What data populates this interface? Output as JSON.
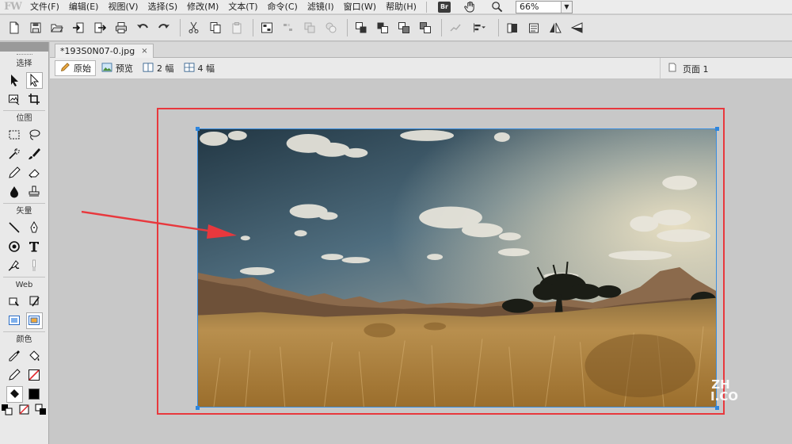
{
  "app": {
    "logo": "FW"
  },
  "menu": {
    "items": [
      "文件(F)",
      "编辑(E)",
      "视图(V)",
      "选择(S)",
      "修改(M)",
      "文本(T)",
      "命令(C)",
      "滤镜(I)",
      "窗口(W)",
      "帮助(H)"
    ],
    "bridge_label": "Br",
    "zoom": "66%"
  },
  "toolbar": {
    "icons": [
      "new-document-icon",
      "save-icon",
      "open-icon",
      "import-icon",
      "export-icon",
      "print-icon",
      "undo-icon",
      "redo-icon",
      "cut-icon",
      "copy-icon",
      "paste-icon",
      "group-icon",
      "ungroup-icon",
      "join-icon",
      "split-icon",
      "bring-front-icon",
      "bring-forward-icon",
      "send-backward-icon",
      "send-back-icon",
      "disabled-align-icon",
      "align-icon",
      "rotate-left-icon",
      "rotate-right-icon",
      "flip-horizontal-icon",
      "flip-vertical-icon"
    ]
  },
  "tools": {
    "sections": {
      "select": "选择",
      "bitmap": "位图",
      "vector": "矢量",
      "web": "Web",
      "colors": "颜色"
    }
  },
  "document": {
    "tab_title": "*193S0N07-0.jpg",
    "tab_close": "×",
    "views": [
      {
        "label": "原始",
        "selected": true
      },
      {
        "label": "预览",
        "selected": false
      },
      {
        "label": "2 幅",
        "selected": false
      },
      {
        "label": "4 幅",
        "selected": false
      }
    ],
    "page_label": "页面 1"
  },
  "canvas": {
    "image_name": "savanna-landscape",
    "highlight_color": "#e8383d",
    "selection_color": "#3b8fe0",
    "watermark": "ZH\nI.CO"
  },
  "colors": {
    "menubar": "#ececec",
    "toolbar": "#e4e4e4",
    "canvas_bg": "#c8c8c8"
  }
}
